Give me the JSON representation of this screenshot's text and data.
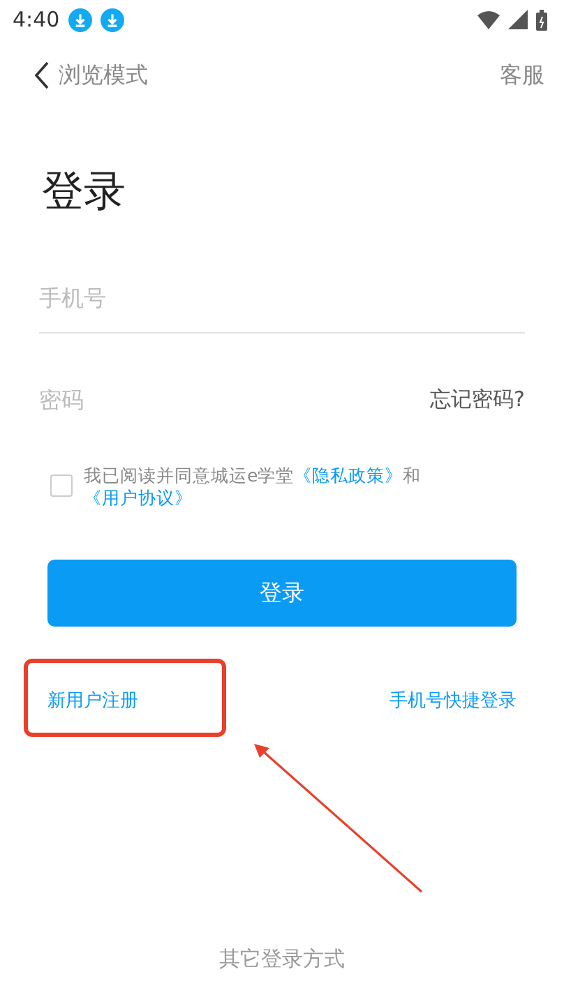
{
  "status_bar": {
    "time": "4:40"
  },
  "header": {
    "back_label": "浏览模式",
    "service": "客服"
  },
  "title": "登录",
  "phone_field": {
    "placeholder": "手机号"
  },
  "password_field": {
    "placeholder": "密码",
    "forgot": "忘记密码?"
  },
  "agreement": {
    "checked": false,
    "parts": [
      {
        "kind": "text",
        "text": "我已阅读并同意城运e学堂"
      },
      {
        "kind": "link",
        "text": "《隐私政策》"
      },
      {
        "kind": "text",
        "text": "和"
      },
      {
        "kind": "link",
        "text": "《用户协议》"
      }
    ]
  },
  "login_button": "登录",
  "register_link": "新用户注册",
  "quick_login_link": "手机号快捷登录",
  "other_login": "其它登录方式"
}
